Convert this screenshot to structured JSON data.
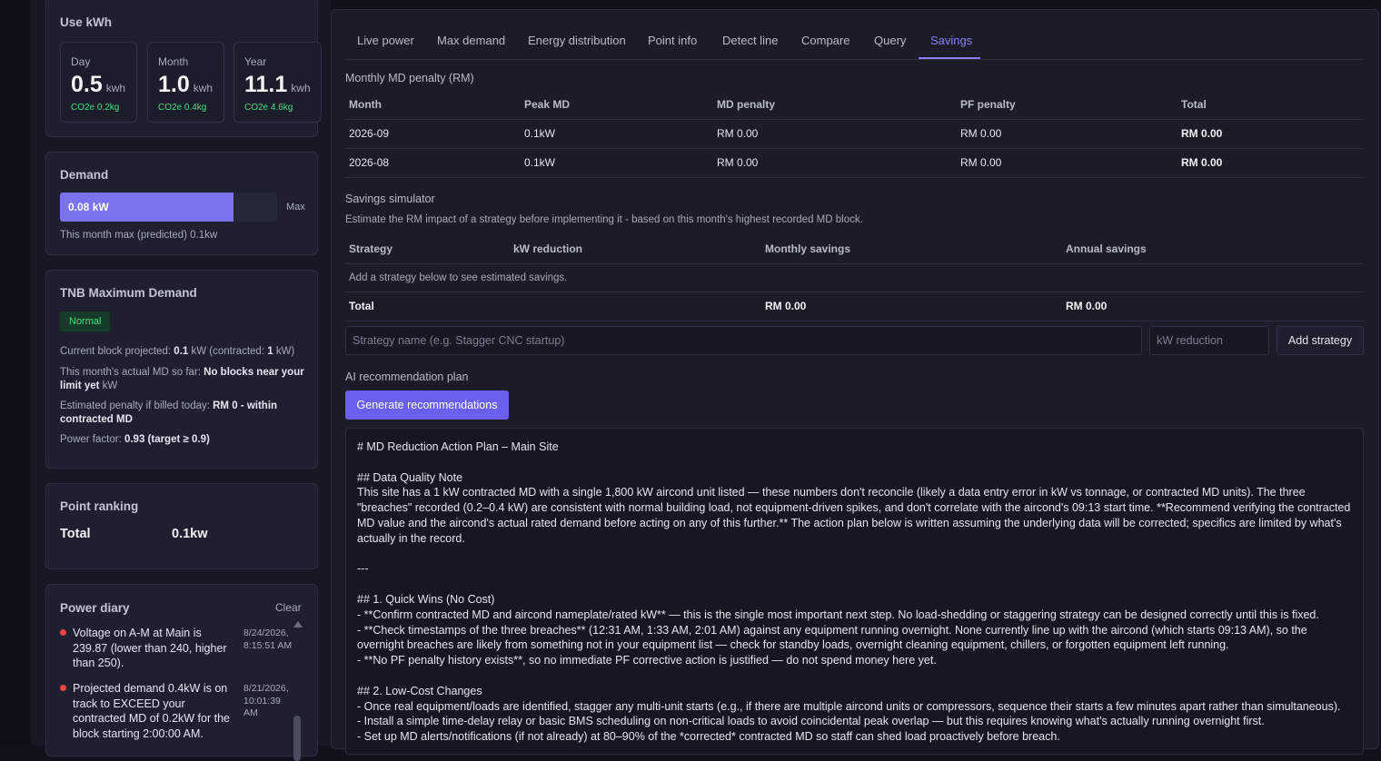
{
  "use_kwh": {
    "title": "Use kWh",
    "boxes": [
      {
        "label": "Day",
        "value": "0.5",
        "unit": "kwh",
        "co2": "CO2e 0.2kg"
      },
      {
        "label": "Month",
        "value": "1.0",
        "unit": "kwh",
        "co2": "CO2e 0.4kg"
      },
      {
        "label": "Year",
        "value": "11.1",
        "unit": "kwh",
        "co2": "CO2e 4.6kg"
      }
    ]
  },
  "demand": {
    "title": "Demand",
    "value_label": "0.08 kW",
    "fill_percent": 80,
    "max_label": "Max",
    "subtitle": "This month max (predicted) 0.1kw"
  },
  "tnb": {
    "title": "TNB Maximum Demand",
    "status": "Normal",
    "status_color": "#4ade80",
    "line1_prefix": "Current block projected: ",
    "line1_value": "0.1",
    "line1_mid": " kW (contracted: ",
    "line1_contracted": "1",
    "line1_suffix": " kW)",
    "line2_prefix": "This month's actual MD so far: ",
    "line2_bold": "No blocks near your limit yet",
    "line2_suffix": " kW",
    "line3_prefix": "Estimated penalty if billed today: ",
    "line3_bold": "RM 0 - within contracted MD",
    "line4_prefix": "Power factor: ",
    "line4_bold": "0.93 (target ≥ 0.9)"
  },
  "ranking": {
    "title": "Point ranking",
    "label": "Total",
    "value": "0.1kw"
  },
  "diary": {
    "title": "Power diary",
    "clear_label": "Clear",
    "entries": [
      {
        "text": "Voltage on A-M at Main is 239.87 (lower than 240, higher than 250).",
        "time": "8/24/2026, 8:15:51 AM"
      },
      {
        "text": "Projected demand 0.4kW is on track to EXCEED your contracted MD of 0.2kW for the block starting 2:00:00 AM.",
        "time": "8/21/2026, 10:01:39 AM"
      }
    ]
  },
  "tabs": [
    "Live power",
    "Max demand",
    "Energy distribution",
    "Point info",
    "Detect line",
    "Compare",
    "Query",
    "Savings"
  ],
  "active_tab": "Savings",
  "penalty": {
    "title": "Monthly MD penalty (RM)",
    "columns": [
      "Month",
      "Peak MD",
      "MD penalty",
      "PF penalty",
      "Total"
    ],
    "rows": [
      [
        "2026-09",
        "0.1kW",
        "RM 0.00",
        "RM 0.00",
        "RM 0.00"
      ],
      [
        "2026-08",
        "0.1kW",
        "RM 0.00",
        "RM 0.00",
        "RM 0.00"
      ]
    ]
  },
  "simulator": {
    "title": "Savings simulator",
    "description": "Estimate the RM impact of a strategy before implementing it - based on this month's highest recorded MD block.",
    "columns": [
      "Strategy",
      "kW reduction",
      "Monthly savings",
      "Annual savings"
    ],
    "empty_text": "Add a strategy below to see estimated savings.",
    "total_label": "Total",
    "total_monthly": "RM 0.00",
    "total_annual": "RM 0.00",
    "strategy_placeholder": "Strategy name (e.g. Stagger CNC startup)",
    "kw_placeholder": "kW reduction",
    "add_button": "Add strategy"
  },
  "ai": {
    "title": "AI recommendation plan",
    "button": "Generate recommendations",
    "plan_lines": [
      "# MD Reduction Action Plan – Main Site",
      "",
      "## Data Quality Note",
      "This site has a 1 kW contracted MD with a single 1,800 kW aircond unit listed — these numbers don't reconcile (likely a data entry error in kW vs tonnage, or contracted MD units). The three \"breaches\" recorded (0.2–0.4 kW) are consistent with normal building load, not equipment-driven spikes, and don't correlate with the aircond's 09:13 start time. **Recommend verifying the contracted MD value and the aircond's actual rated demand before acting on any of this further.** The action plan below is written assuming the underlying data will be corrected; specifics are limited by what's actually in the record.",
      "",
      "---",
      "",
      "## 1. Quick Wins (No Cost)",
      "- **Confirm contracted MD and aircond nameplate/rated kW** — this is the single most important next step. No load-shedding or staggering strategy can be designed correctly until this is fixed.",
      "- **Check timestamps of the three breaches** (12:31 AM, 1:33 AM, 2:01 AM) against any equipment running overnight. None currently line up with the aircond (which starts 09:13 AM), so the overnight breaches are likely from something not in your equipment list — check for standby loads, overnight cleaning equipment, chillers, or forgotten equipment left running.",
      "- **No PF penalty history exists**, so no immediate PF corrective action is justified — do not spend money here yet.",
      "",
      "## 2. Low-Cost Changes",
      "- Once real equipment/loads are identified, stagger any multi-unit starts (e.g., if there are multiple aircond units or compressors, sequence their starts a few minutes apart rather than simultaneous).",
      "- Install a simple time-delay relay or basic BMS scheduling on non-critical loads to avoid coincidental peak overlap — but this requires knowing what's actually running overnight first.",
      "- Set up MD alerts/notifications (if not already) at 80–90% of the *corrected* contracted MD so staff can shed load proactively before breach."
    ]
  }
}
